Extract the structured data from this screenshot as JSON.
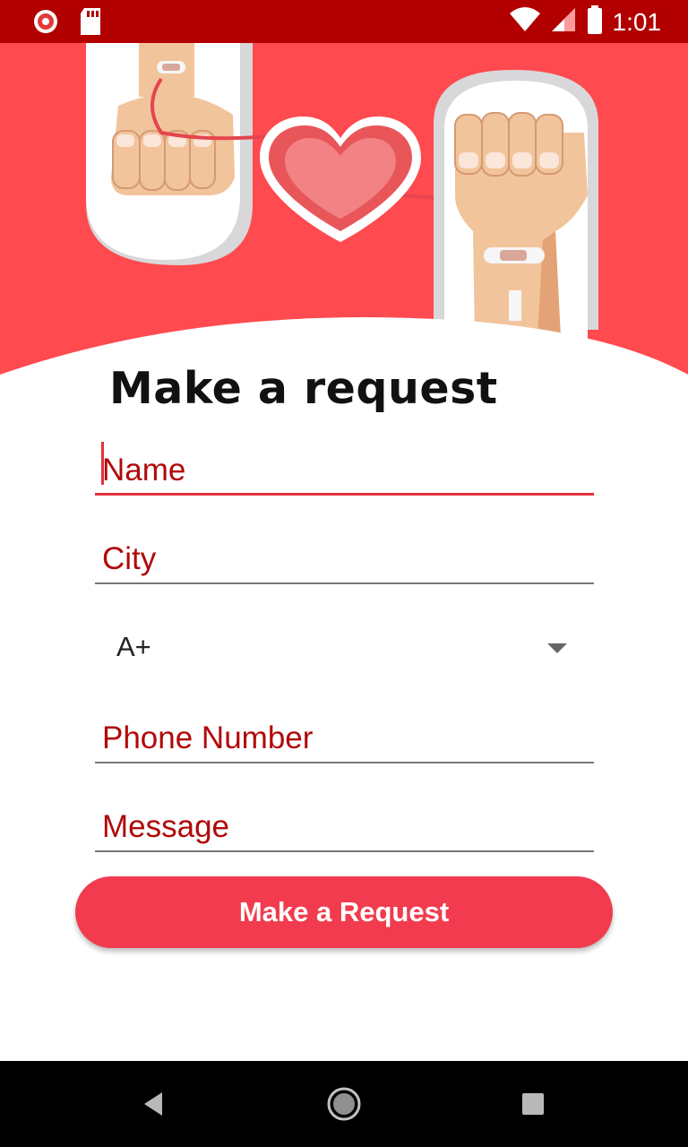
{
  "status_bar": {
    "time": "1:01",
    "icons": [
      "app-notification-icon",
      "sd-card-icon",
      "wifi-icon",
      "signal-icon",
      "battery-icon"
    ]
  },
  "hero": {
    "illustration": "blood-donation-illustration"
  },
  "form": {
    "title": "Make a request",
    "fields": [
      {
        "label": "Name"
      },
      {
        "label": "City"
      },
      {
        "label": "Phone Number"
      },
      {
        "label": "Message"
      }
    ],
    "blood_group": {
      "selected": "A+"
    },
    "submit_label": "Make a Request"
  },
  "nav_bar": {
    "icons": [
      "back-icon",
      "home-icon",
      "recents-icon"
    ]
  },
  "colors": {
    "status_bar": "#b20000",
    "hero_bg": "#ff4a4f",
    "accent": "#f23b4f",
    "label": "#b00a0a"
  }
}
